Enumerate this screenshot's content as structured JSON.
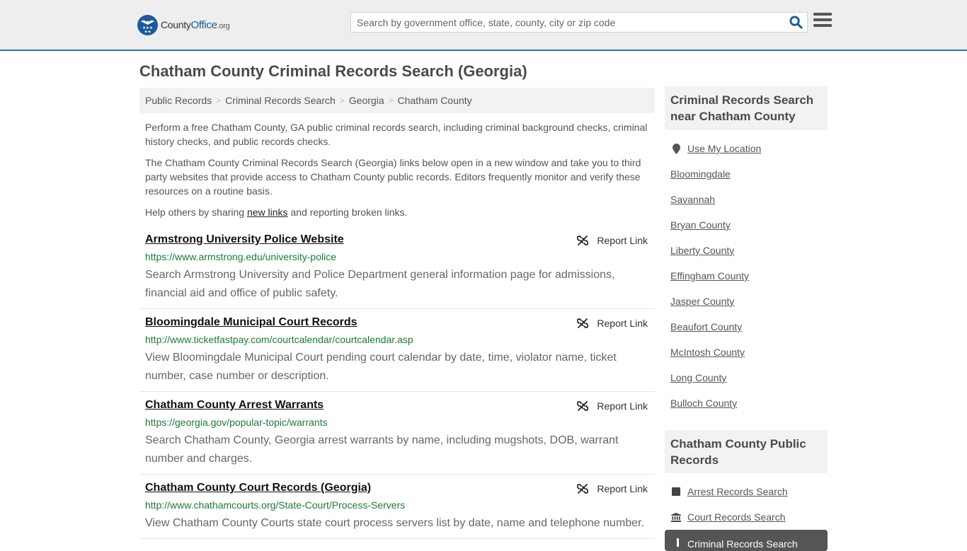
{
  "header": {
    "logo": {
      "name": "County",
      "name_accent": "Office",
      "tld": ".org"
    },
    "search_placeholder": "Search by government office, state, county, city or zip code",
    "accent_color": "#2f73a8"
  },
  "page_title": "Chatham County Criminal Records Search (Georgia)",
  "breadcrumb": [
    "Public Records",
    "Criminal Records Search",
    "Georgia",
    "Chatham County"
  ],
  "intro": {
    "p1": "Perform a free Chatham County, GA public criminal records search, including criminal background checks, criminal history checks, and public records checks.",
    "p2": "The Chatham County Criminal Records Search (Georgia) links below open in a new window and take you to third party websites that provide access to Chatham County public records. Editors frequently monitor and verify these resources on a routine basis.",
    "p3_before": "Help others by sharing ",
    "p3_link": "new links",
    "p3_after": " and reporting broken links."
  },
  "report_label": "Report Link",
  "results": [
    {
      "title": "Armstrong University Police Website",
      "url": "https://www.armstrong.edu/university-police",
      "desc": "Search Armstrong University and Police Department general information page for admissions, financial aid and office of public safety."
    },
    {
      "title": "Bloomingdale Municipal Court Records",
      "url": "http://www.ticketfastpay.com/courtcalendar/courtcalendar.asp",
      "desc": "View Bloomingdale Municipal Court pending court calendar by date, time, violator name, ticket number, case number or description."
    },
    {
      "title": "Chatham County Arrest Warrants",
      "url": "https://georgia.gov/popular-topic/warrants",
      "desc": "Search Chatham County, Georgia arrest warrants by name, including mugshots, DOB, warrant number and charges."
    },
    {
      "title": "Chatham County Court Records (Georgia)",
      "url": "http://www.chathamcourts.org/State-Court/Process-Servers",
      "desc": "View Chatham County Courts state court process servers list by date, name and telephone number."
    }
  ],
  "sidebar": {
    "nearby_title": "Criminal Records Search near Chatham County",
    "use_location": "Use My Location",
    "nearby": [
      "Bloomingdale",
      "Savannah",
      "Bryan County",
      "Liberty County",
      "Effingham County",
      "Jasper County",
      "Beaufort County",
      "McIntosh County",
      "Long County",
      "Bulloch County"
    ],
    "public_title": "Chatham County Public Records",
    "public_links": [
      {
        "label": "Arrest Records Search",
        "icon": "square-icon"
      },
      {
        "label": "Court Records Search",
        "icon": "courthouse-icon"
      }
    ],
    "active_item": "Criminal Records Search"
  }
}
